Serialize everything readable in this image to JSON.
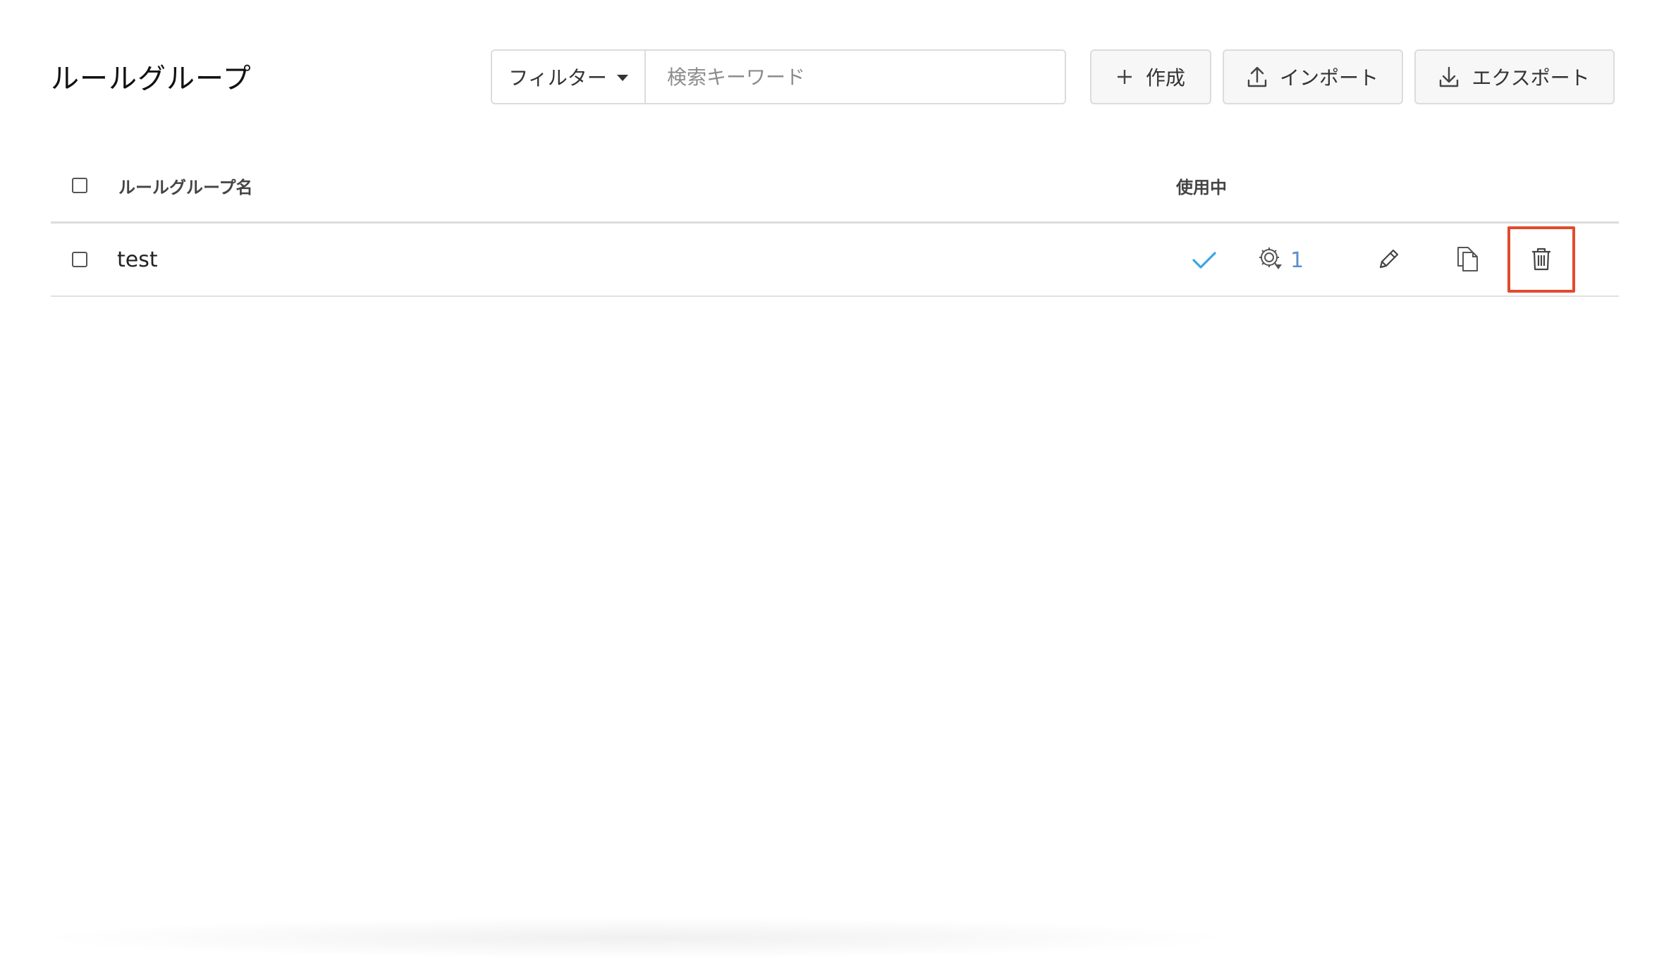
{
  "page": {
    "title": "ルールグループ"
  },
  "search": {
    "filter_label": "フィルター",
    "placeholder": "検索キーワード",
    "value": ""
  },
  "toolbar": {
    "create_label": "作成",
    "import_label": "インポート",
    "export_label": "エクスポート"
  },
  "table": {
    "columns": {
      "name": "ルールグループ名",
      "in_use": "使用中"
    },
    "rows": [
      {
        "name": "test",
        "in_use": true,
        "rule_count": "1"
      }
    ]
  },
  "icons": {
    "create": "plus-icon",
    "import": "upload-icon",
    "export": "download-icon",
    "in_use": "check-icon",
    "rules": "gear-icon",
    "edit": "pencil-icon",
    "copy": "copy-icon",
    "delete": "trash-icon"
  },
  "colors": {
    "accent_check": "#3aa6e6",
    "count_text": "#5a8fc8",
    "highlight": "#e14a2e",
    "border": "#dcdcdc"
  }
}
